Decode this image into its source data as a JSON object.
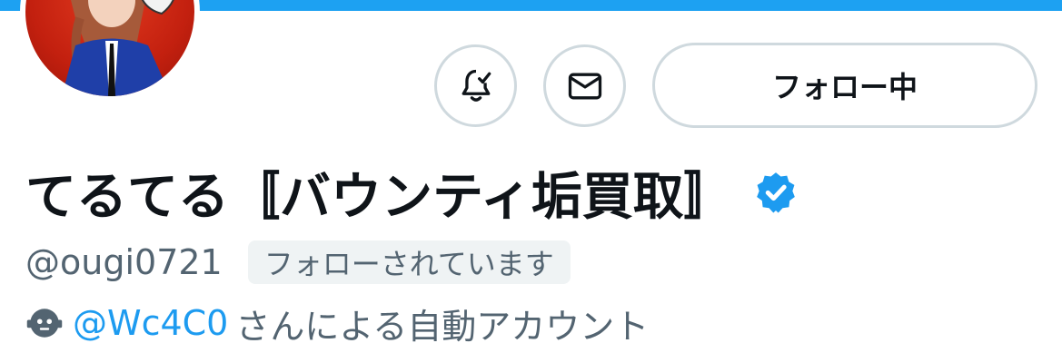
{
  "profile": {
    "display_name": "てるてる〚バウンティ垢買取〛",
    "handle": "@ougi0721",
    "follows_you_label": "フォローされています",
    "automated_by_handle": "@Wc4C0",
    "automated_suffix": "さんによる自動アカウント",
    "verified": true
  },
  "actions": {
    "notifications_icon": "bell-check-icon",
    "message_icon": "envelope-icon",
    "following_label": "フォロー中"
  },
  "colors": {
    "banner": "#1da1f2",
    "verified_badge": "#1d9bf0",
    "link": "#1d9bf0",
    "muted_text": "#536471",
    "button_border": "#cfd9de"
  }
}
